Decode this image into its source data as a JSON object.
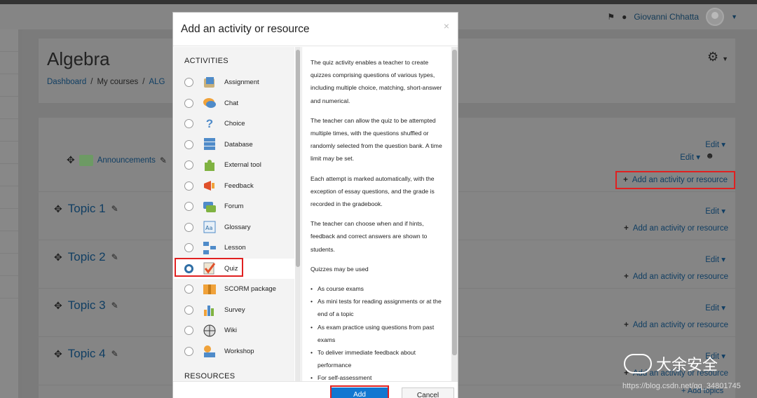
{
  "navbar": {
    "user_name": "Giovanni Chhatta",
    "bell_icon": "bell-icon",
    "chat_icon": "chat-icon"
  },
  "page": {
    "course_title": "Algebra",
    "breadcrumb": [
      "Dashboard",
      "My courses",
      "ALG"
    ],
    "breadcrumb_sep": "/"
  },
  "sections": {
    "general": {
      "announcements": "Announcements",
      "edit": "Edit ▾",
      "edit2": "Edit ▾",
      "add": "Add an activity or resource"
    },
    "topics": [
      {
        "title": "Topic 1",
        "edit": "Edit ▾",
        "add": "Add an activity or resource"
      },
      {
        "title": "Topic 2",
        "edit": "Edit ▾",
        "add": "Add an activity or resource"
      },
      {
        "title": "Topic 3",
        "edit": "Edit ▾",
        "add": "Add an activity or resource"
      },
      {
        "title": "Topic 4",
        "edit": "Edit ▾",
        "add": "Add an activity or resource"
      }
    ],
    "add_topics": "Add topics"
  },
  "modal": {
    "title": "Add an activity or resource",
    "close": "×",
    "activities_header": "ACTIVITIES",
    "resources_header": "RESOURCES",
    "activities": [
      {
        "label": "Assignment",
        "icon": "assignment-icon",
        "selected": false
      },
      {
        "label": "Chat",
        "icon": "chat-icon",
        "selected": false
      },
      {
        "label": "Choice",
        "icon": "choice-icon",
        "selected": false
      },
      {
        "label": "Database",
        "icon": "database-icon",
        "selected": false
      },
      {
        "label": "External tool",
        "icon": "puzzle-icon",
        "selected": false
      },
      {
        "label": "Feedback",
        "icon": "megaphone-icon",
        "selected": false
      },
      {
        "label": "Forum",
        "icon": "forum-icon",
        "selected": false
      },
      {
        "label": "Glossary",
        "icon": "glossary-icon",
        "selected": false
      },
      {
        "label": "Lesson",
        "icon": "lesson-icon",
        "selected": false
      },
      {
        "label": "Quiz",
        "icon": "quiz-icon",
        "selected": true
      },
      {
        "label": "SCORM package",
        "icon": "scorm-icon",
        "selected": false
      },
      {
        "label": "Survey",
        "icon": "survey-icon",
        "selected": false
      },
      {
        "label": "Wiki",
        "icon": "wiki-icon",
        "selected": false
      },
      {
        "label": "Workshop",
        "icon": "workshop-icon",
        "selected": false
      }
    ],
    "description": {
      "paragraphs": [
        "The quiz activity enables a teacher to create quizzes comprising questions of various types, including multiple choice, matching, short-answer and numerical.",
        "The teacher can allow the quiz to be attempted multiple times, with the questions shuffled or randomly selected from the question bank. A time limit may be set.",
        "Each attempt is marked automatically, with the exception of essay questions, and the grade is recorded in the gradebook.",
        "The teacher can choose when and if hints, feedback and correct answers are shown to students.",
        "Quizzes may be used"
      ],
      "bullets": [
        "As course exams",
        "As mini tests for reading assignments or at the end of a topic",
        "As exam practice using questions from past exams",
        "To deliver immediate feedback about performance",
        "For self-assessment"
      ]
    },
    "add_button": "Add",
    "cancel_button": "Cancel"
  },
  "watermark": {
    "text": "大余安全",
    "url": "https://blog.csdn.net/qq_34801745"
  }
}
